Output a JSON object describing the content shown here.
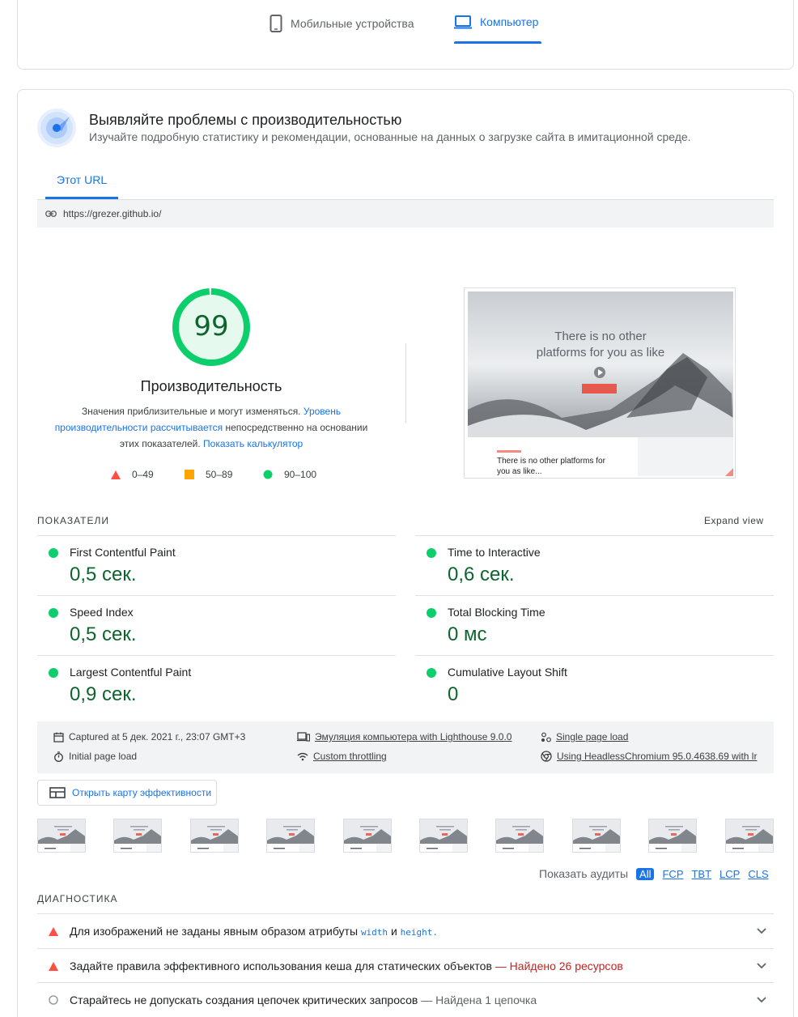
{
  "device_tabs": {
    "mobile": "Мобильные устройства",
    "desktop": "Компьютер"
  },
  "header": {
    "title": "Выявляйте проблемы с производительностью",
    "subtitle": "Изучайте подробную статистику и рекомендации, основанные на данных о загрузке сайта в имитационной среде."
  },
  "url_tab": "Этот URL",
  "url": "https://grezer.github.io/",
  "score": {
    "value": "99",
    "fraction": 0.99,
    "title": "Производительность",
    "desc_1": "Значения приблизительные и могут изменяться.",
    "desc_link_1": "Уровень производительности рассчитывается",
    "desc_2": "непосредственно на основании этих показателей.",
    "desc_link_2": "Показать калькулятор",
    "color": "#0cce6b"
  },
  "legend": {
    "fail": "0–49",
    "average": "50–89",
    "pass": "90–100"
  },
  "screenshot": {
    "hero_line_1": "There is no other",
    "hero_line_2": "platforms for you as like",
    "footer_line_1": "There is no other platforms for",
    "footer_line_2": "you as like..."
  },
  "metrics": {
    "section_label": "ПОКАЗАТЕЛИ",
    "expand": "Expand view",
    "items": [
      {
        "name": "First Contentful Paint",
        "value": "0,5 сек."
      },
      {
        "name": "Time to Interactive",
        "value": "0,6 сек."
      },
      {
        "name": "Speed Index",
        "value": "0,5 сек."
      },
      {
        "name": "Total Blocking Time",
        "value": "0 мс"
      },
      {
        "name": "Largest Contentful Paint",
        "value": "0,9 сек."
      },
      {
        "name": "Cumulative Layout Shift",
        "value": "0"
      }
    ]
  },
  "info": {
    "captured": "Captured at 5 дек. 2021 г., 23:07 GMT+3",
    "initial_load": "Initial page load",
    "emulation": "Эмуляция компьютера with Lighthouse 9.0.0",
    "throttling": "Custom throttling",
    "single_load": "Single page load",
    "browser": "Using HeadlessChromium 95.0.4638.69 with lr"
  },
  "treemap_button": "Открыть карту эффективности",
  "thumbnail_count": 10,
  "filters": {
    "label": "Показать аудиты",
    "items": [
      "All",
      "FCP",
      "TBT",
      "LCP",
      "CLS"
    ]
  },
  "diagnostics": {
    "section_label": "ДИАГНОСТИКА",
    "row1": {
      "text_a": "Для изображений не заданы явным образом атрибуты",
      "code_a": "width",
      "text_b": "и",
      "code_b": "height",
      "text_c": "."
    },
    "row2": {
      "text": "Задайте правила эффективного использования кеша для статических объектов",
      "detail": "— Найдено 26 ресурсов"
    },
    "row3": {
      "text": "Старайтесь не допускать создания цепочек критических запросов",
      "detail": "— Найдена 1 цепочка"
    }
  }
}
